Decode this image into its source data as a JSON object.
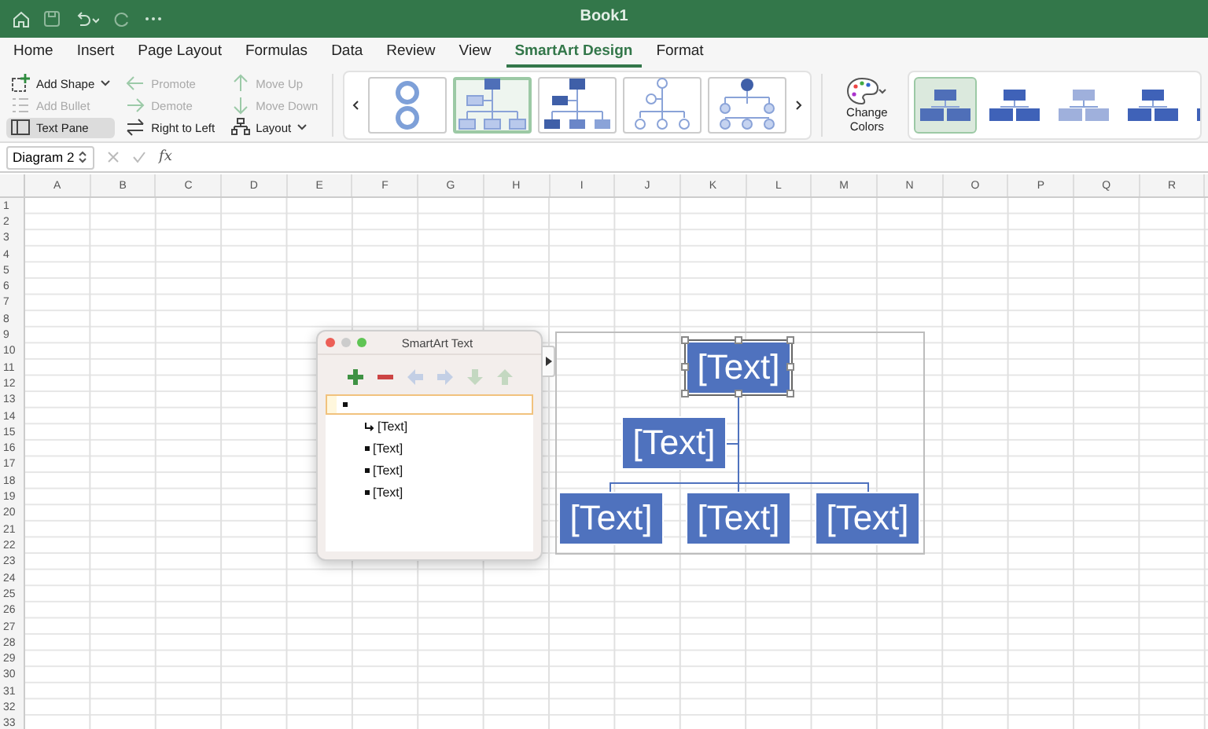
{
  "title_bar": {
    "title": "Book1"
  },
  "tabs": [
    {
      "label": "Home",
      "selected": false
    },
    {
      "label": "Insert",
      "selected": false
    },
    {
      "label": "Page Layout",
      "selected": false
    },
    {
      "label": "Formulas",
      "selected": false
    },
    {
      "label": "Data",
      "selected": false
    },
    {
      "label": "Review",
      "selected": false
    },
    {
      "label": "View",
      "selected": false
    },
    {
      "label": "SmartArt Design",
      "selected": true
    },
    {
      "label": "Format",
      "selected": false
    }
  ],
  "ribbon": {
    "command_columns": [
      [
        {
          "label": "Add Shape",
          "dropdown": true,
          "disabled": false,
          "pressed": false
        },
        {
          "label": "Add Bullet",
          "dropdown": false,
          "disabled": true,
          "pressed": false
        },
        {
          "label": "Text Pane",
          "dropdown": false,
          "disabled": false,
          "pressed": true
        }
      ],
      [
        {
          "label": "Promote",
          "dropdown": false,
          "disabled": true,
          "pressed": false
        },
        {
          "label": "Demote",
          "dropdown": false,
          "disabled": true,
          "pressed": false
        },
        {
          "label": "Right to Left",
          "dropdown": false,
          "disabled": false,
          "pressed": false
        }
      ],
      [
        {
          "label": "Move Up",
          "dropdown": false,
          "disabled": true,
          "pressed": false
        },
        {
          "label": "Move Down",
          "dropdown": false,
          "disabled": true,
          "pressed": false
        },
        {
          "label": "Layout",
          "dropdown": true,
          "disabled": false,
          "pressed": false
        }
      ]
    ],
    "layout_gallery": [
      {
        "selected": false
      },
      {
        "selected": true
      },
      {
        "selected": false
      },
      {
        "selected": false
      },
      {
        "selected": false
      }
    ],
    "change_colors": {
      "label": "Change Colors"
    },
    "style_gallery": [
      {
        "selected": true
      },
      {
        "selected": false
      },
      {
        "selected": false
      },
      {
        "selected": false
      },
      {
        "selected": false
      }
    ]
  },
  "formula_bar": {
    "name_box": "Diagram 2",
    "function_label": "fx"
  },
  "sheet": {
    "columns": [
      "A",
      "B",
      "C",
      "D",
      "E",
      "F",
      "G",
      "H",
      "I",
      "J",
      "K",
      "L",
      "M",
      "N",
      "O",
      "P",
      "Q",
      "R"
    ],
    "rows": [
      "1",
      "2",
      "3",
      "4",
      "5",
      "6",
      "7",
      "8",
      "9",
      "10",
      "11",
      "12",
      "13",
      "14",
      "15",
      "16",
      "17",
      "18",
      "19",
      "20",
      "21",
      "22",
      "23",
      "24",
      "25",
      "26",
      "27",
      "28",
      "29",
      "30",
      "31",
      "32",
      "33"
    ]
  },
  "text_pane": {
    "title": "SmartArt Text",
    "tools": [
      {
        "kind": "add",
        "disabled": false
      },
      {
        "kind": "remove",
        "disabled": false
      },
      {
        "kind": "left",
        "disabled": true
      },
      {
        "kind": "right",
        "disabled": true
      },
      {
        "kind": "down",
        "disabled": true
      },
      {
        "kind": "up",
        "disabled": true
      }
    ],
    "items": [
      {
        "selected": true,
        "kind": "bullet",
        "children": [
          {
            "text": "[Text]",
            "kind": "assistant",
            "selected": false
          },
          {
            "text": "[Text]",
            "kind": "bullet",
            "selected": false
          },
          {
            "text": "[Text]",
            "kind": "bullet",
            "selected": false
          },
          {
            "text": "[Text]",
            "kind": "bullet",
            "selected": false
          }
        ]
      }
    ]
  },
  "diagram": {
    "nodes": [
      {
        "text": "[Text]",
        "kind": "top",
        "selected": true
      },
      {
        "text": "[Text]",
        "kind": "assistant",
        "selected": false
      },
      {
        "text": "[Text]",
        "kind": "bottom",
        "selected": false
      },
      {
        "text": "[Text]",
        "kind": "bottom",
        "selected": false
      },
      {
        "text": "[Text]",
        "kind": "bottom",
        "selected": false
      }
    ]
  }
}
